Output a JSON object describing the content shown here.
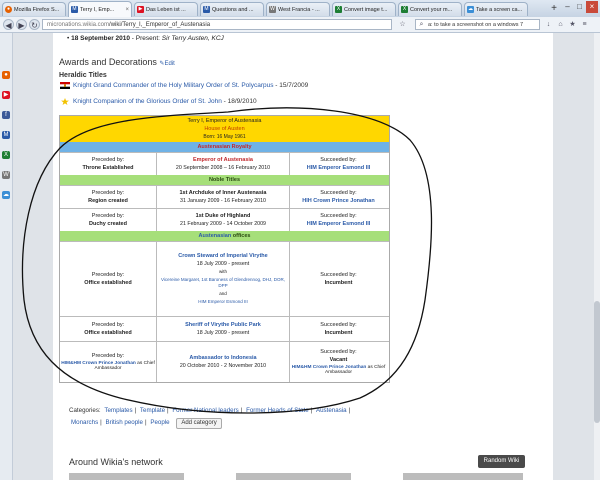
{
  "browser": {
    "tabs": [
      {
        "label": "Mozilla Firefox S...",
        "active": false,
        "icon": "firefox-icon",
        "icon_glyph": "●",
        "icon_color": "#e66000"
      },
      {
        "label": "Terry I, Emp...",
        "active": true,
        "icon": "wikia-icon",
        "icon_glyph": "M",
        "icon_color": "#2a5aa8"
      },
      {
        "label": "Das Leben ist ...",
        "active": false,
        "icon": "youtube-icon",
        "icon_glyph": "▶",
        "icon_color": "#d12"
      },
      {
        "label": "Questions and ...",
        "active": false,
        "icon": "wikia-icon",
        "icon_glyph": "M",
        "icon_color": "#2a5aa8"
      },
      {
        "label": "West Francia - ...",
        "active": false,
        "icon": "wikipedia-icon",
        "icon_glyph": "W",
        "icon_color": "#777"
      },
      {
        "label": "Convert image t...",
        "active": false,
        "icon": "excel-icon",
        "icon_glyph": "X",
        "icon_color": "#1e7e34"
      },
      {
        "label": "Convert your m...",
        "active": false,
        "icon": "excel-icon",
        "icon_glyph": "X",
        "icon_color": "#1e7e34"
      },
      {
        "label": "Take a screen ca...",
        "active": false,
        "icon": "cloud-icon",
        "icon_glyph": "☁",
        "icon_color": "#3b8fd6"
      }
    ],
    "url_host": "micronations.wikia.com",
    "url_path": "/wiki/Terry_I,_Emperor_of_Austenasia",
    "search_text": "a: to take a screenshot on a windows 7"
  },
  "page": {
    "bullet_date": "18 September 2010",
    "bullet_rest": " - Present: ",
    "bullet_title": "Sir Terry Austen, KCJ",
    "awards_heading": "Awards and Decorations",
    "edit_label": "Edit",
    "heraldic_heading": "Heraldic Titles",
    "award1_link": "Knight Grand Commander of the Holy Military Order of St. Polycarpus",
    "award1_date": " - 15/7/2009",
    "award2_link": "Knight Companion of the Glorious Order of St. John",
    "award2_date": " - 18/9/2010"
  },
  "succession": {
    "header_title": "Terry I, Emperor of Austenasia",
    "header_house": "House of Austen",
    "header_born": "Born: 16 May 1961",
    "royalty_label": "Austenasian Royalty",
    "royalty": {
      "preceded_label": "Preceded by:",
      "preceded_value": "Throne Established",
      "title": "Emperor of Austenasia",
      "dates": "20 September 2008 – 16 February 2010",
      "succeeded_label": "Succeeded by:",
      "succeeded_value": "HIM Emperor Esmond III"
    },
    "noble_label": "Noble Titles",
    "noble": [
      {
        "preceded_label": "Preceded by:",
        "preceded_value": "Region created",
        "title": "1st Archduke of Inner Austenasia",
        "dates": "31 January 2009 - 16 February 2010",
        "succeeded_label": "Succeeded by:",
        "succeeded_value": "HIH Crown Prince Jonathan"
      },
      {
        "preceded_label": "Preceded by:",
        "preceded_value": "Duchy created",
        "title": "1st Duke of Highland",
        "dates": "21 February 2009 - 14 October 2009",
        "succeeded_label": "Succeeded by:",
        "succeeded_value": "HIM Emperor Esmond III"
      }
    ],
    "offices_label_link": "Austenasian",
    "offices_label_rest": " offices",
    "offices": [
      {
        "preceded_label": "Preceded by:",
        "preceded_value": "Office established",
        "title": "Crown Steward of Imperial Virythe",
        "dates": "18 July 2009 - present",
        "with_label": "with",
        "with_names": "Vicereine Margaret, 1st Baroness of Glendrennog, DHJ, DOR, DPP",
        "and_label": "and",
        "and_names": "HIM Emperor Esmond III",
        "succeeded_label": "Succeeded by:",
        "succeeded_value": "Incumbent"
      },
      {
        "preceded_label": "Preceded by:",
        "preceded_value": "Office established",
        "title": "Sheriff of Virythe Public Park",
        "dates": "18 July 2009 - present",
        "succeeded_label": "Succeeded by:",
        "succeeded_value": "Incumbent"
      },
      {
        "preceded_label": "Preceded by:",
        "preceded_value_link": "HIM&HM Crown Prince Jonathan",
        "preceded_value_rest": " as Chief Ambassador",
        "title": "Ambassador to Indonesia",
        "dates": "20 October 2010 - 2 November 2010",
        "succeeded_label": "Succeeded by:",
        "succeeded_value": "Vacant",
        "succeeded_link": "HIM&HM Crown Prince Jonathan",
        "succeeded_rest": " as Chief Ambassador"
      }
    ]
  },
  "categories": {
    "label": "Categories:",
    "items": [
      "Templates",
      "Template",
      "Former National leaders",
      "Former Heads of State",
      "Austenasia",
      "Monarchs",
      "British people",
      "People"
    ],
    "add_label": "Add category"
  },
  "footer": {
    "around_label": "Around Wikia's network",
    "random_wiki": "Random Wiki"
  },
  "colors": {
    "header_gold": "#ffd700",
    "royalty_blue": "#6fb2e6",
    "noble_green": "#a6df7a",
    "link_blue": "#2a5aa8",
    "title_red": "#c0282c"
  }
}
